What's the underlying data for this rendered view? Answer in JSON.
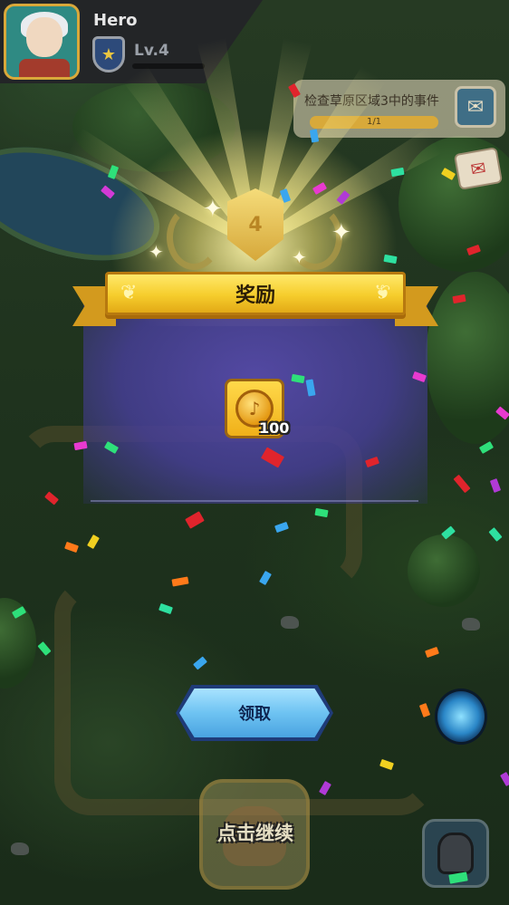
{
  "hero": {
    "name": "Hero",
    "level": "Lv.4",
    "rank_icon": "star-shield-icon",
    "avatar_icon": "hero-avatar"
  },
  "quest": {
    "text": "检查草原区域3中的事件",
    "progress_label": "1/1",
    "progress": 1.0,
    "map_button_icon": "scroll-map-icon"
  },
  "mail": {
    "icon": "envelope-icon"
  },
  "reward_dialog": {
    "title": "奖励",
    "badge_level": "4",
    "items": [
      {
        "icon": "gold-coin-icon",
        "quantity": "100"
      }
    ],
    "claim_label": "领取"
  },
  "bottom": {
    "continue_label": "点击继续",
    "helmet_icon": "helmet-icon",
    "portal_icon": "portal-icon"
  },
  "colors": {
    "banner_gold": "#f6cd2c",
    "panel_purple": "#5648aa",
    "claim_blue": "#6ec3f2",
    "background_green": "#263a23"
  }
}
